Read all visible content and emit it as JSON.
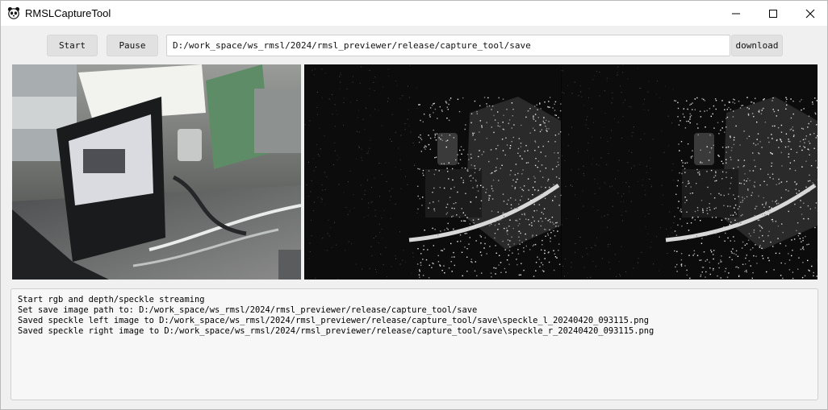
{
  "window": {
    "title": "RMSLCaptureTool",
    "app_icon": "panda-icon",
    "controls": [
      "minimize-icon",
      "maximize-icon",
      "close-icon"
    ]
  },
  "toolbar": {
    "start_label": "Start",
    "pause_label": "Pause",
    "save_path": "D:/work_space/ws_rmsl/2024/rmsl_previewer/release/capture_tool/save",
    "download_label": "download"
  },
  "previews": {
    "rgb": "rgb camera frame (desk, laptop, cables)",
    "speckle": "speckle left/right infrared frames"
  },
  "log": {
    "lines": [
      "Start rgb and depth/speckle streaming",
      "Set save image path to: D:/work_space/ws_rmsl/2024/rmsl_previewer/release/capture_tool/save",
      "Saved speckle left image to D:/work_space/ws_rmsl/2024/rmsl_previewer/release/capture_tool/save\\speckle_l_20240420_093115.png",
      "Saved speckle right image to D:/work_space/ws_rmsl/2024/rmsl_previewer/release/capture_tool/save\\speckle_r_20240420_093115.png"
    ]
  }
}
